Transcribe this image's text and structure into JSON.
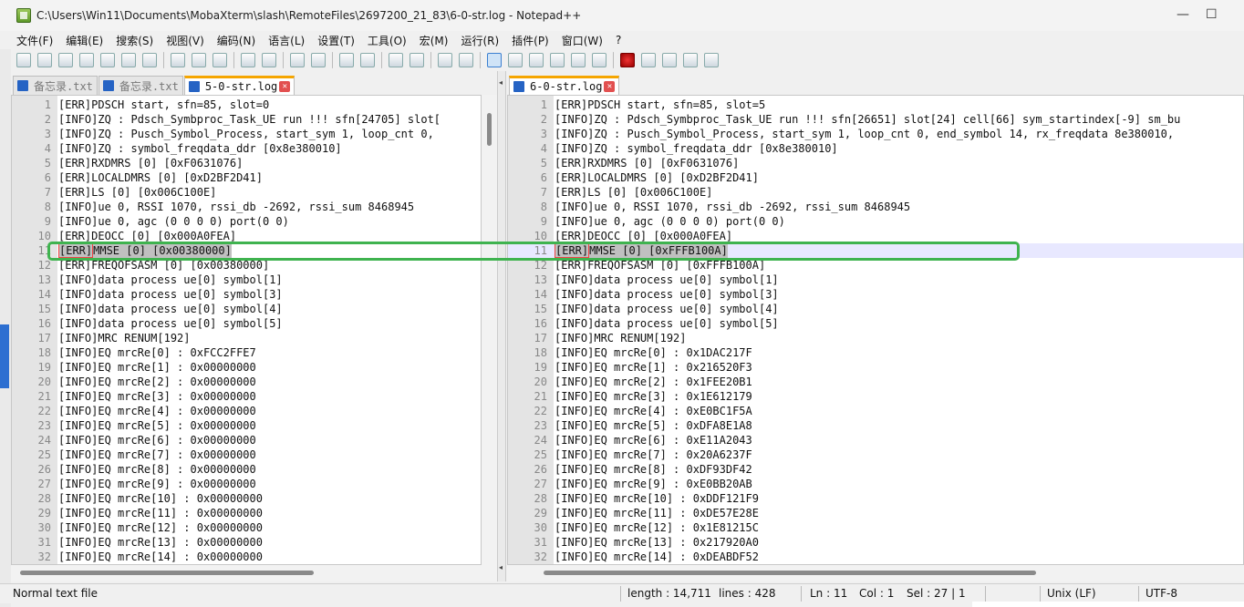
{
  "window": {
    "title": "C:\\Users\\Win11\\Documents\\MobaXterm\\slash\\RemoteFiles\\2697200_21_83\\6-0-str.log - Notepad++",
    "minimize_label": "—",
    "maximize_label": "☐"
  },
  "menu": {
    "items": [
      "文件(F)",
      "编辑(E)",
      "搜索(S)",
      "视图(V)",
      "编码(N)",
      "语言(L)",
      "设置(T)",
      "工具(O)",
      "宏(M)",
      "运行(R)",
      "插件(P)",
      "窗口(W)",
      "?"
    ]
  },
  "left_pane": {
    "tabs": [
      {
        "label": "备忘录.txt",
        "active": false
      },
      {
        "label": "备忘录.txt",
        "active": false
      },
      {
        "label": "5-0-str.log",
        "active": true
      }
    ],
    "lines": [
      "[ERR]PDSCH start, sfn=85, slot=0",
      "[INFO]ZQ : Pdsch_Symbproc_Task_UE run !!! sfn[24705] slot[",
      "[INFO]ZQ : Pusch_Symbol_Process, start_sym 1, loop_cnt 0,",
      "[INFO]ZQ : symbol_freqdata_ddr [0x8e380010]",
      "[ERR]RXDMRS [0] [0xF0631076]",
      "[ERR]LOCALDMRS [0] [0xD2BF2D41]",
      "[ERR]LS [0] [0x006C100E]",
      "[INFO]ue 0, RSSI 1070, rssi_db -2692, rssi_sum 8468945",
      "[INFO]ue 0, agc (0 0 0 0) port(0 0)",
      "[ERR]DEOCC [0] [0x000A0FEA]",
      "[ERR]MMSE [0] [0x00380000]",
      "[ERR]FREQOFSASM [0] [0x00380000]",
      "[INFO]data process ue[0] symbol[1]",
      "[INFO]data process ue[0] symbol[3]",
      "[INFO]data process ue[0] symbol[4]",
      "[INFO]data process ue[0] symbol[5]",
      "[INFO]MRC RENUM[192]",
      "[INFO]EQ mrcRe[0] : 0xFCC2FFE7",
      "[INFO]EQ mrcRe[1] : 0x00000000",
      "[INFO]EQ mrcRe[2] : 0x00000000",
      "[INFO]EQ mrcRe[3] : 0x00000000",
      "[INFO]EQ mrcRe[4] : 0x00000000",
      "[INFO]EQ mrcRe[5] : 0x00000000",
      "[INFO]EQ mrcRe[6] : 0x00000000",
      "[INFO]EQ mrcRe[7] : 0x00000000",
      "[INFO]EQ mrcRe[8] : 0x00000000",
      "[INFO]EQ mrcRe[9] : 0x00000000",
      "[INFO]EQ mrcRe[10] : 0x00000000",
      "[INFO]EQ mrcRe[11] : 0x00000000",
      "[INFO]EQ mrcRe[12] : 0x00000000",
      "[INFO]EQ mrcRe[13] : 0x00000000",
      "[INFO]EQ mrcRe[14] : 0x00000000"
    ]
  },
  "right_pane": {
    "tabs": [
      {
        "label": "6-0-str.log",
        "active": true
      }
    ],
    "lines": [
      "[ERR]PDSCH start, sfn=85, slot=5",
      "[INFO]ZQ : Pdsch_Symbproc_Task_UE run !!! sfn[26651] slot[24] cell[66] sym_startindex[-9] sm_bu",
      "[INFO]ZQ : Pusch_Symbol_Process, start_sym 1, loop_cnt 0, end_symbol 14, rx_freqdata 8e380010,",
      "[INFO]ZQ : symbol_freqdata_ddr [0x8e380010]",
      "[ERR]RXDMRS [0] [0xF0631076]",
      "[ERR]LOCALDMRS [0] [0xD2BF2D41]",
      "[ERR]LS [0] [0x006C100E]",
      "[INFO]ue 0, RSSI 1070, rssi_db -2692, rssi_sum 8468945",
      "[INFO]ue 0, agc (0 0 0 0) port(0 0)",
      "[ERR]DEOCC [0] [0x000A0FEA]",
      "[ERR]MMSE [0] [0xFFFB100A]",
      "[ERR]FREQOFSASM [0] [0xFFFB100A]",
      "[INFO]data process ue[0] symbol[1]",
      "[INFO]data process ue[0] symbol[3]",
      "[INFO]data process ue[0] symbol[4]",
      "[INFO]data process ue[0] symbol[5]",
      "[INFO]MRC RENUM[192]",
      "[INFO]EQ mrcRe[0] : 0x1DAC217F",
      "[INFO]EQ mrcRe[1] : 0x216520F3",
      "[INFO]EQ mrcRe[2] : 0x1FEE20B1",
      "[INFO]EQ mrcRe[3] : 0x1E612179",
      "[INFO]EQ mrcRe[4] : 0xE0BC1F5A",
      "[INFO]EQ mrcRe[5] : 0xDFA8E1A8",
      "[INFO]EQ mrcRe[6] : 0xE11A2043",
      "[INFO]EQ mrcRe[7] : 0x20A6237F",
      "[INFO]EQ mrcRe[8] : 0xDF93DF42",
      "[INFO]EQ mrcRe[9] : 0xE0BB20AB",
      "[INFO]EQ mrcRe[10] : 0xDDF121F9",
      "[INFO]EQ mrcRe[11] : 0xDE57E28E",
      "[INFO]EQ mrcRe[12] : 0x1E81215C",
      "[INFO]EQ mrcRe[13] : 0x217920A0",
      "[INFO]EQ mrcRe[14] : 0xDEABDF52"
    ]
  },
  "highlighted_line": 11,
  "status": {
    "file_type": "Normal text file",
    "length": "length : 14,711",
    "lines": "lines : 428",
    "ln": "Ln : 11",
    "col": "Col : 1",
    "sel": "Sel : 27 | 1",
    "eol": "Unix (LF)",
    "encoding": "UTF-8"
  },
  "colors": {
    "highlight_box": "#3fb34f",
    "active_tab_accent": "#f5a500"
  }
}
